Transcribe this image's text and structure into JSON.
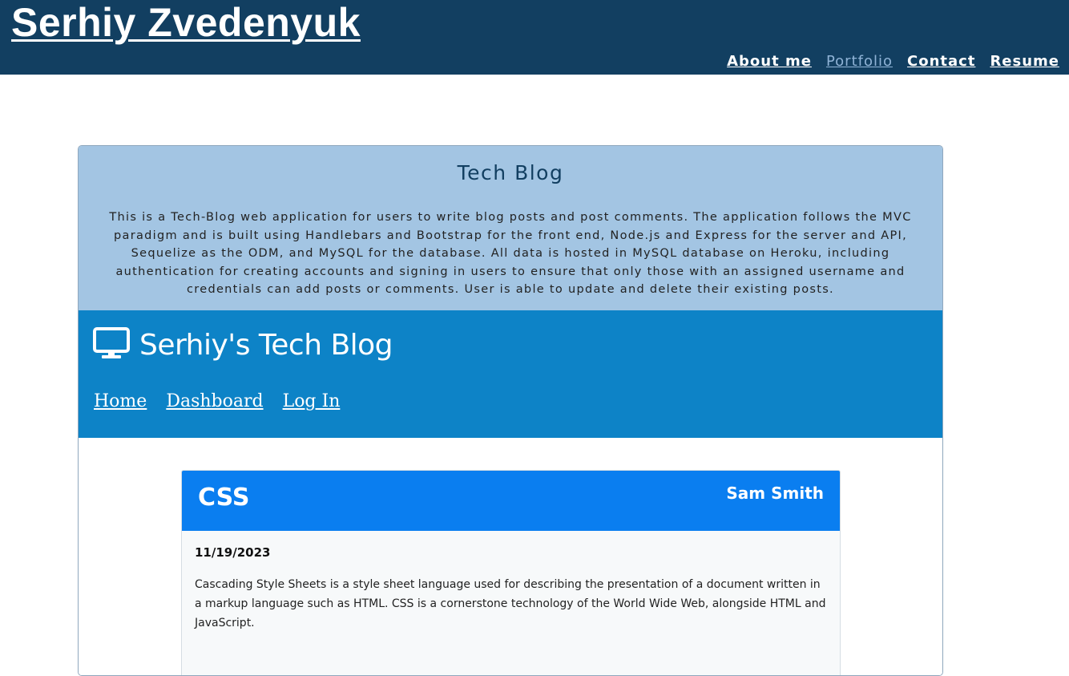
{
  "site": {
    "title": "Serhiy Zvedenyuk",
    "nav": [
      {
        "label": "About me",
        "active": false
      },
      {
        "label": "Portfolio",
        "active": true
      },
      {
        "label": "Contact",
        "active": false
      },
      {
        "label": "Resume",
        "active": false
      }
    ]
  },
  "project": {
    "title": "Tech Blog",
    "description": "This is a Tech-Blog web application for users to write blog posts and post comments. The application follows the MVC paradigm and is built using Handlebars and Bootstrap for the front end, Node.js and Express for the server and API, Sequelize as the ODM, and MySQL for the database. All data is hosted in MySQL database on Heroku, including authentication for creating accounts and signing in users to ensure that only those with an assigned username and credentials can add posts or comments. User is able to update and delete their existing posts.",
    "screenshot": {
      "brand_icon": "monitor-icon",
      "brand": "Serhiy's Tech Blog",
      "nav": [
        "Home",
        "Dashboard",
        "Log In"
      ],
      "post": {
        "title": "CSS",
        "author": "Sam Smith",
        "date": "11/19/2023",
        "body": "Cascading Style Sheets is a style sheet language used for describing the presentation of a document written in a markup language such as HTML. CSS is a cornerstone technology of the World Wide Web, alongside HTML and JavaScript."
      }
    }
  },
  "colors": {
    "header_bg": "#123f61",
    "card_head_bg": "#a3c5e3",
    "shot_header_bg": "#0d83c7",
    "post_head_bg": "#0a7ef0",
    "active_nav": "#8fb3d6"
  }
}
